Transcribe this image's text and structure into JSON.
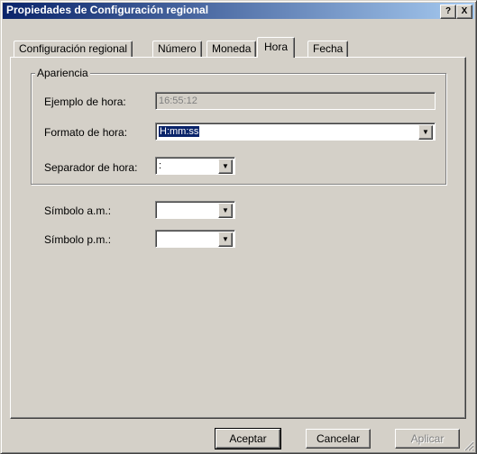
{
  "window": {
    "title": "Propiedades de Configuración regional",
    "help_button": "?",
    "close_button": "X"
  },
  "tabs": [
    {
      "label": "Configuración regional",
      "active": false
    },
    {
      "label": "Número",
      "active": false
    },
    {
      "label": "Moneda",
      "active": false
    },
    {
      "label": "Hora",
      "active": true
    },
    {
      "label": "Fecha",
      "active": false
    }
  ],
  "appearance": {
    "legend": "Apariencia",
    "example_label": "Ejemplo de hora:",
    "example_value": "16:55:12",
    "format_label": "Formato de hora:",
    "format_value": "H:mm:ss",
    "separator_label": "Separador de hora:",
    "separator_value": ":"
  },
  "symbols": {
    "am_label": "Símbolo a.m.:",
    "am_value": "",
    "pm_label": "Símbolo p.m.:",
    "pm_value": ""
  },
  "buttons": {
    "ok": "Aceptar",
    "cancel": "Cancelar",
    "apply": "Aplicar"
  }
}
